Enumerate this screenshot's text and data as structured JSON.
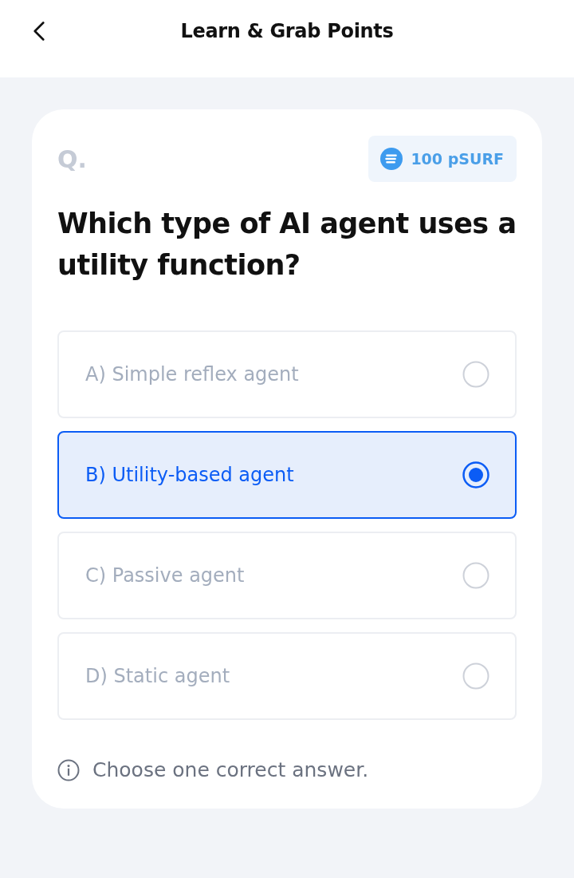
{
  "header": {
    "title": "Learn & Grab Points"
  },
  "question": {
    "label": "Q.",
    "reward": "100 pSURF",
    "text": "Which type of AI agent uses a utility function?"
  },
  "options": [
    {
      "label": "A) Simple reflex agent",
      "selected": false
    },
    {
      "label": "B) Utility-based agent",
      "selected": true
    },
    {
      "label": "C) Passive agent",
      "selected": false
    },
    {
      "label": "D) Static agent",
      "selected": false
    }
  ],
  "hint": "Choose one correct answer."
}
